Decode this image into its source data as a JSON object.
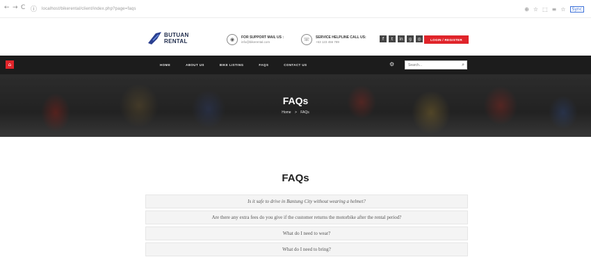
{
  "browser": {
    "back": "←",
    "forward": "→",
    "reload": "C",
    "secure": "ⓘ",
    "url": "localhost/bikerental/client/index.php?page=faqs",
    "ext_icons": [
      "⊕",
      "☆",
      "⬚",
      "≡",
      "☆"
    ],
    "profile_label": "Sync"
  },
  "site": {
    "logo_text_line1": "BUTUAN",
    "logo_text_line2": "RENTAL",
    "support": {
      "icon": "◉",
      "title": "FOR SUPPORT MAIL US :",
      "detail": "info@bikerental.com"
    },
    "service": {
      "icon": "☏",
      "title": "SERVICE HELPLINE CALL US:",
      "detail": "+63 123 456 789"
    },
    "socials": [
      "f",
      "t",
      "in",
      "g",
      "◎"
    ],
    "book_label": "LOGIN / REGISTER"
  },
  "nav": {
    "home_icon": "⌂",
    "items": [
      "HOME",
      "ABOUT US",
      "BIKE LISTING",
      "FAQS",
      "CONTACT US"
    ],
    "cart_icon": "⚙",
    "search_placeholder": "Search...",
    "search_icon": "⌕"
  },
  "hero": {
    "title": "FAQs",
    "breadcrumb_home": "Home",
    "breadcrumb_sep": ">",
    "breadcrumb_current": "FAQs"
  },
  "faq": {
    "heading": "FAQs",
    "items": [
      "Is it safe to drive in Bantung City without wearing a helmet?",
      "Are there any extra fees do you give if the customer returns the motorbike after the rental period?",
      "What do I need to wear?",
      "What do I need to bring?"
    ]
  }
}
